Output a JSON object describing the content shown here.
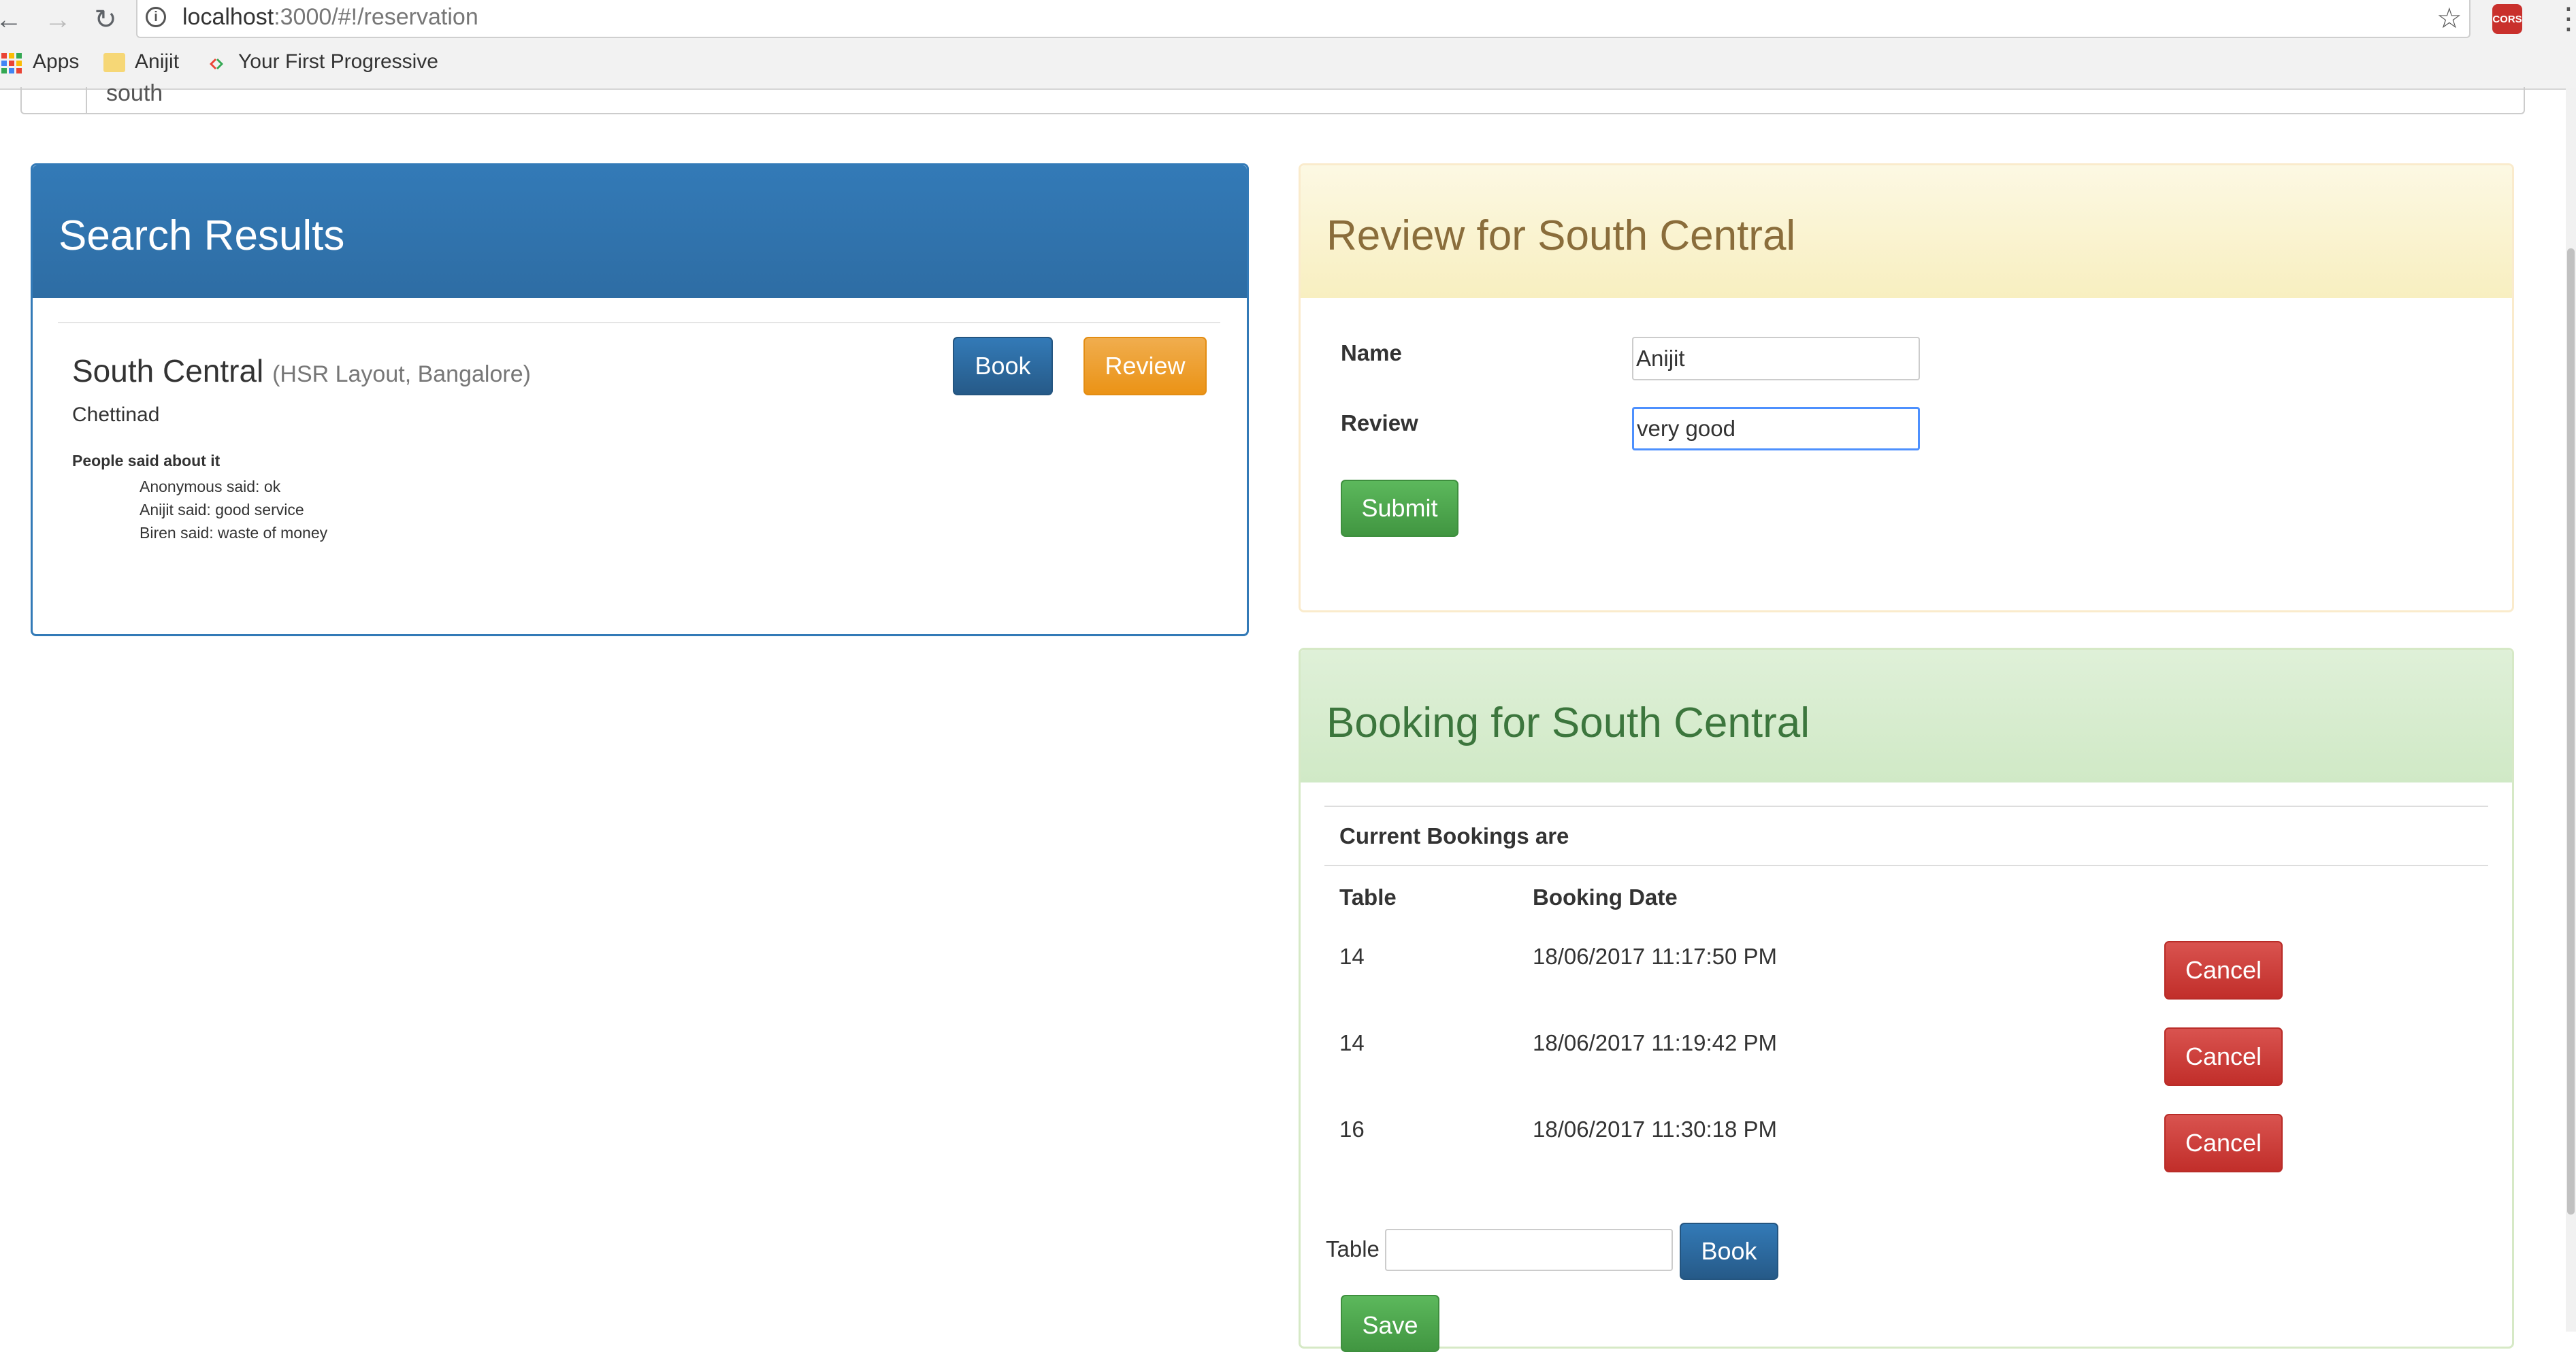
{
  "browser": {
    "url_host": "localhost",
    "url_path": ":3000/#!/reservation",
    "cors_badge": "CORS",
    "bookmarks": {
      "apps": "Apps",
      "folder": "Anijit",
      "page": "Your First Progressive"
    },
    "icons": [
      "back-icon",
      "forward-icon",
      "reload-icon",
      "info-icon",
      "star-icon",
      "menu-icon"
    ]
  },
  "search": {
    "value": "south",
    "icon": "search-icon"
  },
  "results": {
    "title": "Search Results",
    "restaurant": {
      "name": "South Central",
      "location": "(HSR Layout, Bangalore)",
      "cuisine": "Chettinad",
      "book_label": "Book",
      "review_label": "Review",
      "said_title": "People said about it",
      "reviews": [
        "Anonymous said: ok",
        "Anijit said: good service",
        "Biren said: waste of money"
      ]
    }
  },
  "review_form": {
    "title": "Review for South Central",
    "name_label": "Name",
    "name_value": "Anijit",
    "review_label": "Review",
    "review_value": "very good",
    "submit_label": "Submit"
  },
  "booking": {
    "title": "Booking for South Central",
    "current_label": "Current Bookings are",
    "columns": [
      "Table",
      "Booking Date"
    ],
    "rows": [
      {
        "table": "14",
        "date": "18/06/2017 11:17:50 PM",
        "action": "Cancel"
      },
      {
        "table": "14",
        "date": "18/06/2017 11:19:42 PM",
        "action": "Cancel"
      },
      {
        "table": "16",
        "date": "18/06/2017 11:30:18 PM",
        "action": "Cancel"
      }
    ],
    "table_label": "Table",
    "table_value": "",
    "book_label": "Book",
    "save_label": "Save"
  },
  "colors": {
    "primary": "#337ab7",
    "warning": "#f0ad4e",
    "success": "#5cb85c",
    "danger": "#d9534f",
    "review_heading": "#8a6d3b",
    "booking_heading": "#3c763d"
  }
}
